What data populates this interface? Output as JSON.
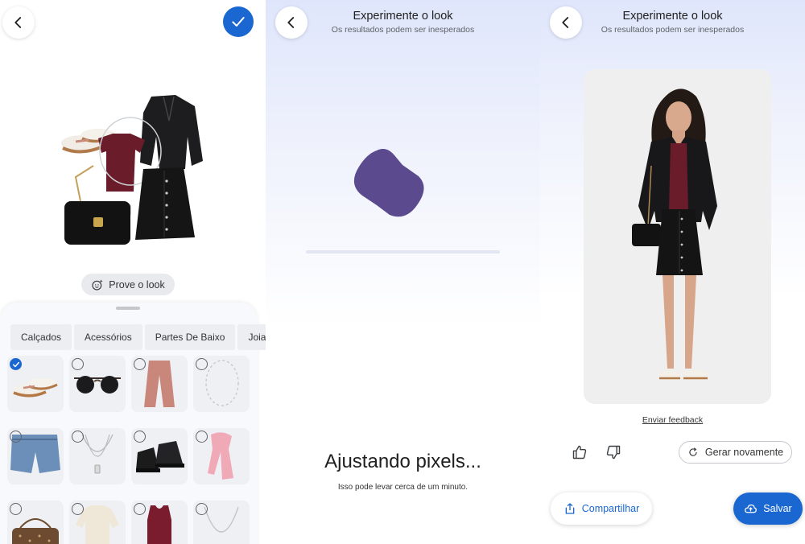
{
  "selector": {
    "try_label": "Prove o look",
    "tabs": [
      {
        "label": "Calçados"
      },
      {
        "label": "Acessórios"
      },
      {
        "label": "Partes De Baixo"
      },
      {
        "label": "Joias"
      }
    ],
    "items": [
      {
        "icon": "sneakers-icon",
        "selected": true
      },
      {
        "icon": "sunglasses-icon",
        "selected": false
      },
      {
        "icon": "pants-icon",
        "selected": false
      },
      {
        "icon": "necklace-icon",
        "selected": false
      },
      {
        "icon": "denim-shorts-icon",
        "selected": false
      },
      {
        "icon": "pendant-necklace-icon",
        "selected": false
      },
      {
        "icon": "boots-icon",
        "selected": false
      },
      {
        "icon": "scarf-icon",
        "selected": false
      },
      {
        "icon": "handbag-icon",
        "selected": false
      },
      {
        "icon": "sweater-icon",
        "selected": false
      },
      {
        "icon": "tank-top-icon",
        "selected": false
      },
      {
        "icon": "chain-necklace-icon",
        "selected": false
      }
    ]
  },
  "loading": {
    "title": "Experimente o look",
    "subtitle": "Os resultados podem ser inesperados",
    "message": "Ajustando pixels...",
    "submessage": "Isso pode levar cerca de um minuto."
  },
  "result": {
    "title": "Experimente o look",
    "subtitle": "Os resultados podem ser inesperados",
    "feedback_label": "Enviar feedback",
    "regenerate_label": "Gerar novamente",
    "share_label": "Compartilhar",
    "save_label": "Salvar"
  },
  "colors": {
    "accent": "#1a67d2",
    "logo": "#5b4a8e"
  }
}
